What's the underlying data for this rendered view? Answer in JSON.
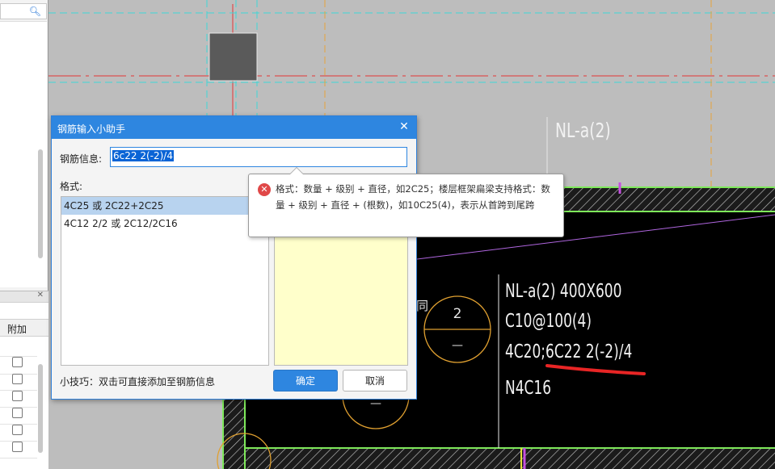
{
  "left_panel": {
    "search_icon": "search-icon",
    "close_glyph": "✕",
    "column_header": "附加"
  },
  "cad": {
    "label_top": "NL-a(2)",
    "annotation_lines": [
      "NL-a(2) 400X600",
      "C10@100(4)",
      "4C20;6C22 2(-2)/4",
      "N4C16"
    ],
    "circle_label_top": "2",
    "circle_label_bottom": "—",
    "circle2_label": "—",
    "partial_char": "同",
    "colors": {
      "background_gray": "#bdbdbd",
      "black_area": "#000000",
      "axis_red": "#e33636",
      "dash_cyan": "#3fd6d6",
      "dash_orange": "#e8a33c",
      "hatch_green": "#7ee85a",
      "underline_red": "#e82525",
      "magenta": "#c64fe0"
    }
  },
  "dialog": {
    "title": "钢筋输入小助手",
    "close_glyph": "✕",
    "info_label": "钢筋信息:",
    "info_value": "6c22 2(-2)/4",
    "format_label": "格式:",
    "formats": [
      "4C25 或 2C22+2C25",
      "4C12 2/2 或 2C12/2C16"
    ],
    "selected_index": 0,
    "tip": "小技巧：双击可直接添加至钢筋信息",
    "ok_label": "确定",
    "cancel_label": "取消"
  },
  "tooltip": {
    "icon": "error-icon",
    "icon_glyph": "✕",
    "text": "格式：数量 + 级别 + 直径，如2C25；楼层框架扁梁支持格式：数量 + 级别 + 直径 + (根数)，如10C25(4)，表示从首跨到尾跨"
  }
}
